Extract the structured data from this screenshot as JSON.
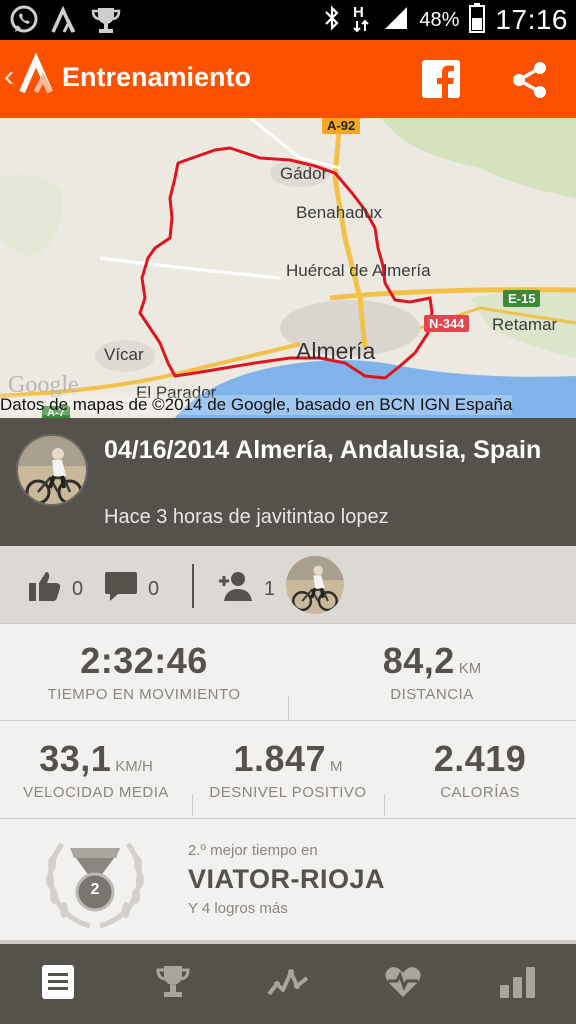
{
  "status_bar": {
    "battery_pct": "48%",
    "time": "17:16",
    "icons": [
      "whatsapp-icon",
      "strava-icon",
      "trophy-icon",
      "bluetooth-icon",
      "hsdpa-icon",
      "signal-icon",
      "battery-icon"
    ]
  },
  "app_bar": {
    "title": "Entrenamiento",
    "back_glyph": "‹",
    "actions": [
      "facebook-icon",
      "share-icon"
    ],
    "accent_color": "#fc5200"
  },
  "map": {
    "labels": {
      "gador": "Gádor",
      "benahadux": "Benahadux",
      "huercal": "Huércal de Almería",
      "almeria": "Almería",
      "vicar": "Vícar",
      "el_parador": "El Parador",
      "retamar": "Retamar"
    },
    "roads": {
      "a92": "A-92",
      "e15": "E-15",
      "n344": "N-344",
      "a7": "A-7"
    },
    "google_logo": "Google",
    "attribution": "Datos de mapas de ©2014 de Google, basado en BCN IGN España",
    "route_color": "#e0141e"
  },
  "activity": {
    "title": "04/16/2014 Almería, Andalusia, Spain",
    "subtitle": "Hace 3 horas de javitintao lopez"
  },
  "social": {
    "kudos_count": "0",
    "comments_count": "0",
    "athletes_count": "1"
  },
  "stats": {
    "moving_time": {
      "value": "2:32:46",
      "unit": "",
      "label": "TIEMPO EN MOVIMIENTO"
    },
    "distance": {
      "value": "84,2",
      "unit": "KM",
      "label": "DISTANCIA"
    },
    "avg_speed": {
      "value": "33,1",
      "unit": "KM/H",
      "label": "VELOCIDAD MEDIA"
    },
    "elevation": {
      "value": "1.847",
      "unit": "M",
      "label": "DESNIVEL POSITIVO"
    },
    "calories": {
      "value": "2.419",
      "unit": "",
      "label": "CALORÍAS"
    }
  },
  "achievement": {
    "rank_text": "2.º mejor tiempo en",
    "medal_number": "2",
    "segment": "VIATOR-RIOJA",
    "more": "Y 4 logros más"
  },
  "bottom_nav": {
    "tabs": [
      "overview-icon",
      "trophy-icon",
      "elevation-icon",
      "heart-rate-icon",
      "analysis-icon"
    ],
    "active": "overview-icon"
  }
}
